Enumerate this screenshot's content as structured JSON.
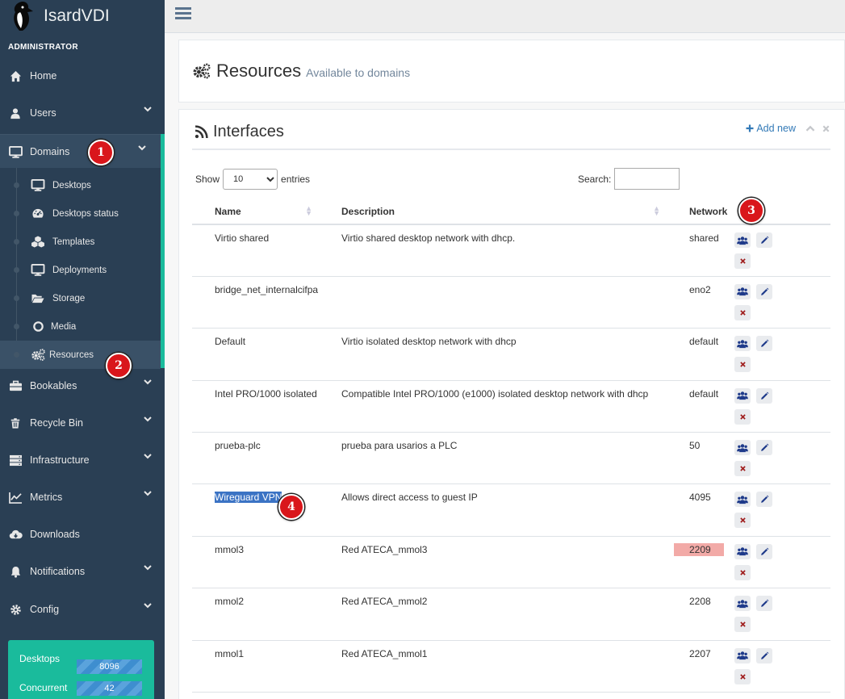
{
  "app": {
    "title": "IsardVDI",
    "role": "ADMINISTRATOR"
  },
  "sidebar": {
    "items": [
      {
        "label": "Home",
        "icon": "home-icon",
        "chevron": false
      },
      {
        "label": "Users",
        "icon": "user-icon",
        "chevron": true
      },
      {
        "label": "Domains",
        "icon": "desktop-icon",
        "chevron": true,
        "active": true
      },
      {
        "label": "Bookables",
        "icon": "briefcase-icon",
        "chevron": true
      },
      {
        "label": "Recycle Bin",
        "icon": "trash-icon",
        "chevron": true
      },
      {
        "label": "Infrastructure",
        "icon": "server-icon",
        "chevron": true
      },
      {
        "label": "Metrics",
        "icon": "line-chart-icon",
        "chevron": true
      },
      {
        "label": "Downloads",
        "icon": "cloud-download-icon",
        "chevron": false
      },
      {
        "label": "Notifications",
        "icon": "bell-icon",
        "chevron": true
      },
      {
        "label": "Config",
        "icon": "gear-icon",
        "chevron": true
      }
    ],
    "subitems": [
      {
        "label": "Desktops",
        "icon": "desktop-icon"
      },
      {
        "label": "Desktops status",
        "icon": "dashboard-icon"
      },
      {
        "label": "Templates",
        "icon": "cubes-icon"
      },
      {
        "label": "Deployments",
        "icon": "desktop-icon"
      },
      {
        "label": "Storage",
        "icon": "folder-open-icon"
      },
      {
        "label": "Media",
        "icon": "circle-icon"
      },
      {
        "label": "Resources",
        "icon": "gears-icon",
        "active": true
      }
    ],
    "stats": [
      {
        "label": "Desktops",
        "value": "8096"
      },
      {
        "label": "Concurrent",
        "value": "42"
      }
    ]
  },
  "page": {
    "title": "Resources",
    "subtitle": "Available to domains"
  },
  "interfaces": {
    "title": "Interfaces",
    "add_label": "Add new",
    "show_label": "Show",
    "entries_label": "entries",
    "page_length": "10",
    "search_label": "Search:",
    "search_value": "",
    "columns": [
      "Name",
      "Description",
      "Network"
    ],
    "rows": [
      {
        "name": "Virtio shared",
        "description": "Virtio shared desktop network with dhcp.",
        "network": "shared"
      },
      {
        "name": "bridge_net_internalcifpa",
        "description": "",
        "network": "eno2"
      },
      {
        "name": "Default",
        "description": "Virtio isolated desktop network with dhcp",
        "network": "default"
      },
      {
        "name": "Intel PRO/1000 isolated",
        "description": "Compatible Intel PRO/1000 (e1000) isolated desktop network with dhcp",
        "network": "default"
      },
      {
        "name": "prueba-plc",
        "description": "prueba para usarios a PLC",
        "network": "50"
      },
      {
        "name": "Wireguard VPN",
        "description": "Allows direct access to guest IP",
        "network": "4095"
      },
      {
        "name": "mmol3",
        "description": "Red ATECA_mmol3",
        "network": "2209"
      },
      {
        "name": "mmol2",
        "description": "Red ATECA_mmol2",
        "network": "2208"
      },
      {
        "name": "mmol1",
        "description": "Red ATECA_mmol1",
        "network": "2207"
      }
    ]
  },
  "callouts": [
    "1",
    "2",
    "3",
    "4"
  ],
  "colors": {
    "sidebar": "#2a3f54",
    "accent": "#1abb9c",
    "callout": "#d9161b",
    "selection": "#3b73c4",
    "highlight": "#f2aaa7"
  }
}
